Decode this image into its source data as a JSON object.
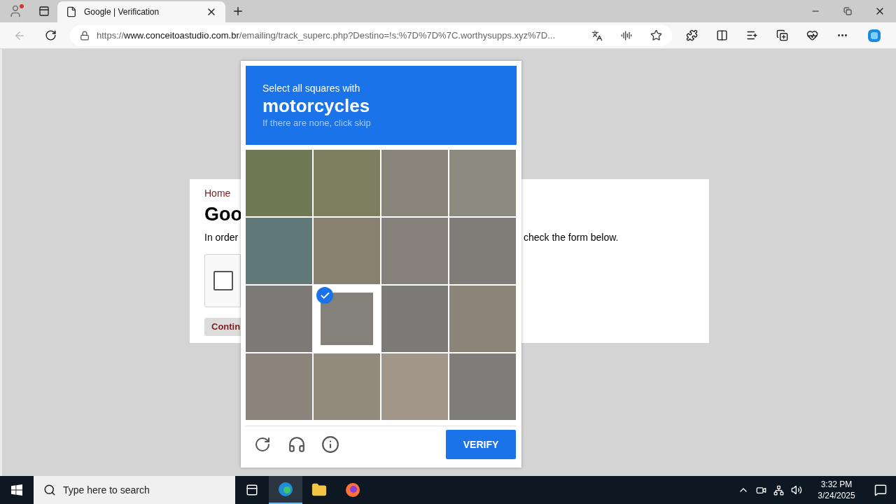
{
  "browser": {
    "tab": {
      "title": "Google | Verification",
      "selected": true
    },
    "url": {
      "scheme": "https://",
      "domain": "www.conceitoastudio.com.br",
      "path": "/emailing/track_superc.php?Destino=!s:%7D%7D%7C.worthysupps.xyz%7D..."
    }
  },
  "page": {
    "breadcrumb": "Home",
    "heading": "Goo",
    "intro_left": "In order",
    "intro_right": "check the form below.",
    "robot_checkbox": {
      "checked": false
    },
    "continue_button": "Contin"
  },
  "captcha": {
    "prompt": "Select all squares with",
    "target": "motorcycles",
    "hint": "If there are none, click skip",
    "tiles": [
      {
        "selected": false
      },
      {
        "selected": false
      },
      {
        "selected": false
      },
      {
        "selected": false
      },
      {
        "selected": false
      },
      {
        "selected": false
      },
      {
        "selected": false
      },
      {
        "selected": false
      },
      {
        "selected": false
      },
      {
        "selected": true
      },
      {
        "selected": false
      },
      {
        "selected": false
      },
      {
        "selected": false
      },
      {
        "selected": false
      },
      {
        "selected": false
      },
      {
        "selected": false
      }
    ],
    "verify_button": "VERIFY"
  },
  "taskbar": {
    "search_placeholder": "Type here to search",
    "time": "3:32 PM",
    "date": "3/24/2025"
  }
}
